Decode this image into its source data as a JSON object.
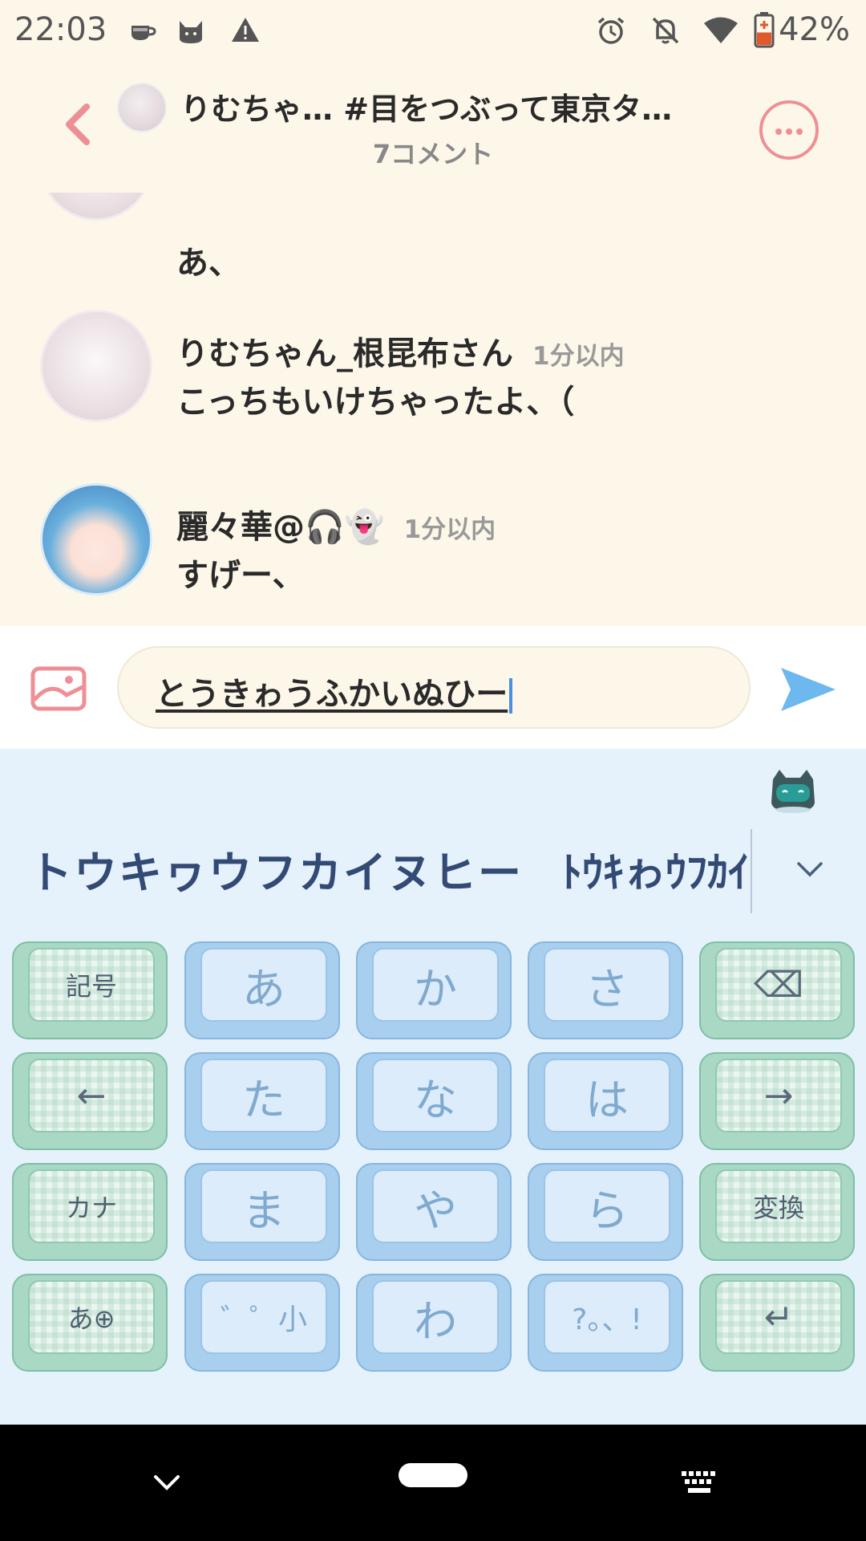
{
  "status_bar": {
    "time": "22:03",
    "left_icons": [
      "coffee-icon",
      "cat-icon",
      "warning-icon"
    ],
    "right_icons": [
      "alarm-icon",
      "notifications-off-icon",
      "wifi-icon",
      "battery-icon"
    ],
    "battery": "42%",
    "battery_level": 0.42,
    "battery_color": "#e05a2c"
  },
  "header": {
    "title": "りむちゃ…  #目をつぶって東京タ…",
    "subtitle": "7コメント",
    "accent_color": "#ee8f96"
  },
  "comments": [
    {
      "name": "",
      "time": "",
      "text": "あ、"
    },
    {
      "name": "りむちゃん_根昆布さん",
      "time": "1分以内",
      "text": "こっちもいけちゃったよ、（"
    },
    {
      "name": "麗々華@🎧👻",
      "time": "1分以内",
      "text": "すげー、"
    }
  ],
  "composer": {
    "input_value": "とうきゎうふかいぬひー",
    "send_color": "#6cb8ef"
  },
  "keyboard": {
    "candidates": {
      "main": "トウキヮウフカイヌヒー",
      "alt": "ﾄｳｷゎｳﾌｶｲﾇﾋｰ"
    },
    "keys": [
      {
        "label": "記号",
        "type": "green"
      },
      {
        "label": "あ",
        "type": "blue"
      },
      {
        "label": "か",
        "type": "blue"
      },
      {
        "label": "さ",
        "type": "blue"
      },
      {
        "label": "⌫",
        "type": "green"
      },
      {
        "label": "←",
        "type": "green"
      },
      {
        "label": "た",
        "type": "blue"
      },
      {
        "label": "な",
        "type": "blue"
      },
      {
        "label": "は",
        "type": "blue"
      },
      {
        "label": "→",
        "type": "green"
      },
      {
        "label": "カナ",
        "type": "green"
      },
      {
        "label": "ま",
        "type": "blue"
      },
      {
        "label": "や",
        "type": "blue"
      },
      {
        "label": "ら",
        "type": "blue"
      },
      {
        "label": "変換",
        "type": "green"
      },
      {
        "label": "あ⊕",
        "type": "green"
      },
      {
        "label": "゛゜小",
        "type": "blue"
      },
      {
        "label": "わ",
        "type": "blue"
      },
      {
        "label": "?。、!",
        "type": "blue"
      },
      {
        "label": "↵",
        "type": "green"
      }
    ]
  }
}
